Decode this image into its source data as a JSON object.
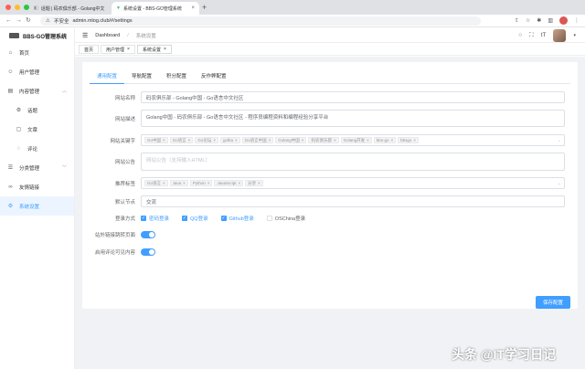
{
  "browser": {
    "tabs": [
      {
        "title": "话题 | 码农俱乐部 - Golang中文"
      },
      {
        "title": "系统设置 - BBS-GO管理系统"
      }
    ],
    "security_label": "不安全",
    "url": "admin.mlog.club/#/settings"
  },
  "sidebar": {
    "brand": "BBS-GO管理系统",
    "items": [
      {
        "label": "首页",
        "icon": "home-icon"
      },
      {
        "label": "用户管理",
        "icon": "user-icon"
      },
      {
        "label": "内容管理",
        "icon": "document-icon"
      },
      {
        "label": "话题",
        "icon": "gear-icon"
      },
      {
        "label": "文章",
        "icon": "document-icon"
      },
      {
        "label": "评论",
        "icon": "comment-icon"
      },
      {
        "label": "分类管理",
        "icon": "category-icon"
      },
      {
        "label": "友情链接",
        "icon": "link-icon"
      },
      {
        "label": "系统设置",
        "icon": "settings-icon"
      }
    ]
  },
  "header": {
    "breadcrumb": [
      "Dashboard",
      "系统设置"
    ]
  },
  "view_tags": [
    {
      "label": "首页"
    },
    {
      "label": "用户管理"
    },
    {
      "label": "系统设置"
    }
  ],
  "settings": {
    "tabs": [
      "通用配置",
      "导航配置",
      "积分配置",
      "反作弊配置"
    ],
    "site_name_label": "网站名称",
    "site_name_value": "码农俱乐部 - Golang中国 - Go语言中文社区",
    "site_desc_label": "网站描述",
    "site_desc_value": "Golang中国 - 码农俱乐部 - Go语言中文社区 - 程序员编程资料和编程经验分享平台",
    "keywords_label": "网站关键字",
    "keywords": [
      "Go中国",
      "Go语言",
      "Go论坛",
      "golba",
      "Go语言中国",
      "Golang中国",
      "码农俱乐部",
      "Golang开发",
      "bbs-go",
      "bbsgo"
    ],
    "notice_label": "网站公告",
    "notice_placeholder": "网站公告（支持输入HTML）",
    "recommend_label": "推荐标签",
    "recommend_tags": [
      "Go语言",
      "Java",
      "Python",
      "JavaScript",
      "分享"
    ],
    "default_node_label": "默认节点",
    "default_node_value": "交流",
    "login_label": "登录方式",
    "login_methods": [
      {
        "label": "密码登录",
        "checked": true
      },
      {
        "label": "QQ登录",
        "checked": true
      },
      {
        "label": "Github登录",
        "checked": true
      },
      {
        "label": "OSChina登录",
        "checked": false
      }
    ],
    "external_link_label": "站外链接跳转页面",
    "comment_visible_label": "启用评论可见内容",
    "save_label": "保存配置"
  },
  "watermark": "头条 @IT学习日记",
  "colors": {
    "accent": "#409eff"
  }
}
